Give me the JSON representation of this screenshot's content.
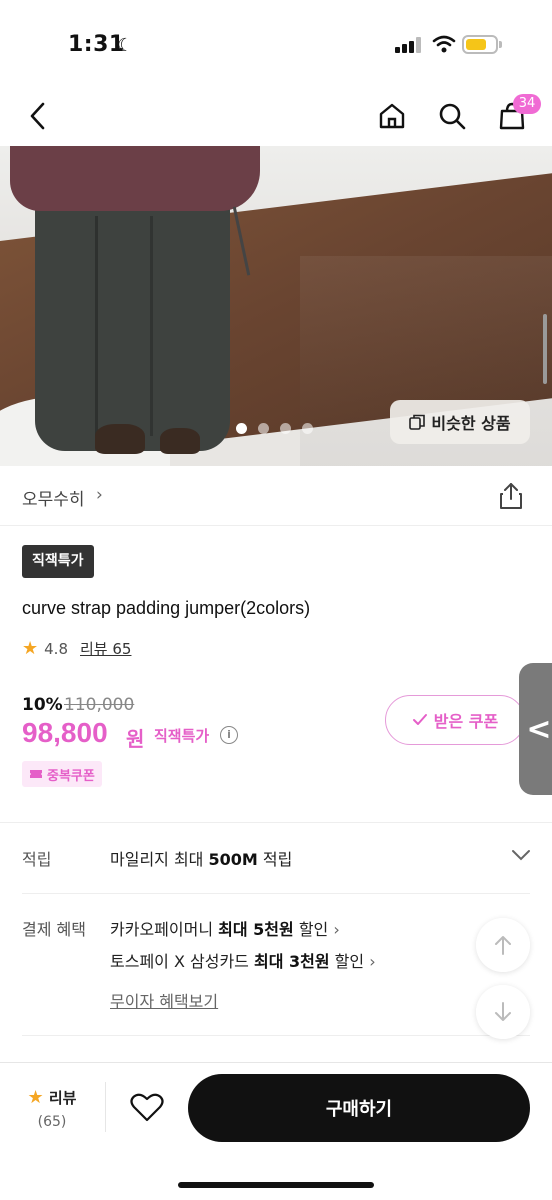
{
  "status_bar": {
    "time": "1:31",
    "moon_icon": "moon-icon",
    "signal_icon": "cellular-signal-icon",
    "wifi_icon": "wifi-icon",
    "battery_icon": "battery-icon",
    "battery_color": "#f5c518"
  },
  "header": {
    "back_icon": "chevron-left-icon",
    "home_icon": "home-icon",
    "search_icon": "search-icon",
    "cart_icon": "shopping-bag-icon",
    "cart_badge": "34",
    "badge_color": "#f06bd4"
  },
  "hero": {
    "slide_count": 4,
    "active_slide": 1,
    "similar_button": "비슷한 상품"
  },
  "brand": {
    "name": "오무수히",
    "chevron": "›",
    "share_icon": "share-icon"
  },
  "product": {
    "tag": "직잭특가",
    "title": "curve strap padding jumper(2colors)",
    "rating": "4.8",
    "review_link": "리뷰 65",
    "discount_pct": "10%",
    "original_price": "110,000",
    "price": "98,800",
    "currency": "원",
    "price_tag": "직잭특가",
    "coupon_button": "받은 쿠폰",
    "dup_coupon": "중복쿠폰",
    "accent_color": "#e55fc8"
  },
  "side_tab": {
    "label": "<"
  },
  "mileage": {
    "label": "적립",
    "text_prefix": "마일리지 최대 ",
    "text_bold": "500M",
    "text_suffix": " 적립"
  },
  "payment": {
    "label": "결제 혜택",
    "line1_prefix": "카카오페이머니 ",
    "line1_bold": "최대 5천원",
    "line1_suffix": " 할인",
    "line2_prefix": "토스페이 X 삼성카드 ",
    "line2_bold": "최대 3천원",
    "line2_suffix": " 할인",
    "benefit_link": "무이자 혜택보기"
  },
  "bottom_bar": {
    "review_label": "리뷰",
    "review_count": "(65)",
    "buy_button": "구매하기"
  }
}
